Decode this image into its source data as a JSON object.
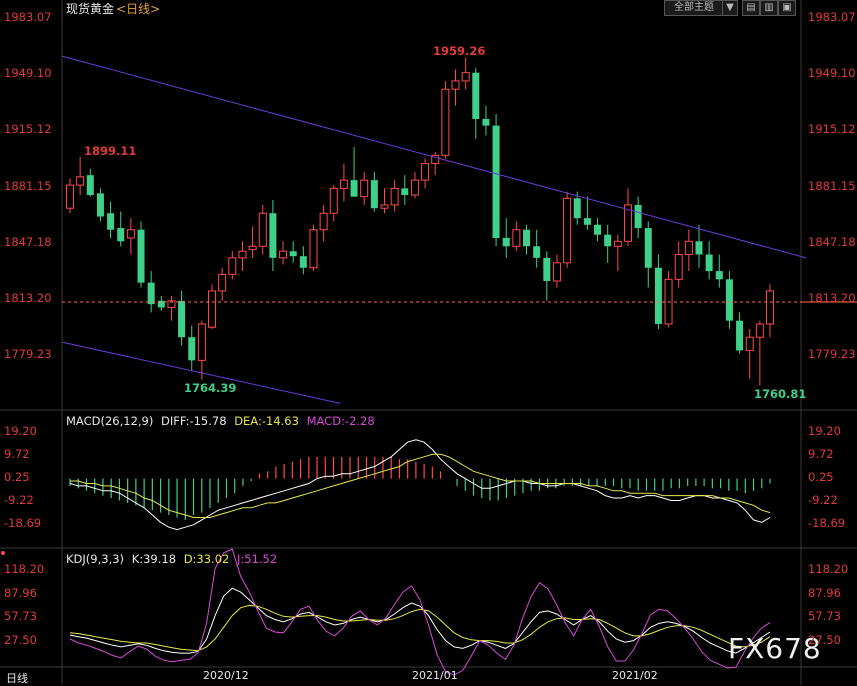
{
  "header": {
    "symbol": "现货黄金",
    "period": "<日线>",
    "theme_button": "全部主题",
    "theme_arrow": "▼",
    "buttons": [
      "▤",
      "▥",
      "▣"
    ]
  },
  "price_axis": {
    "labels": [
      "1983.07",
      "1949.10",
      "1915.12",
      "1881.15",
      "1847.18",
      "1813.20",
      "1779.23"
    ],
    "values": [
      1983.07,
      1949.1,
      1915.12,
      1881.15,
      1847.18,
      1813.2,
      1779.23
    ],
    "current": 1811.3
  },
  "annotations": {
    "high": "1959.26",
    "left_high": "1899.11",
    "left_low": "1764.39",
    "right_low": "1760.81"
  },
  "macd": {
    "title": "MACD(26,12,9)",
    "diff": "DIFF:-15.78",
    "dea": "DEA:-14.63",
    "macd": "MACD:-2.28",
    "axis_labels": [
      "19.20",
      "9.72",
      "0.25",
      "-9.22",
      "-18.69"
    ],
    "axis_values": [
      19.2,
      9.72,
      0.25,
      -9.22,
      -18.69
    ],
    "hist": [
      -3,
      -4,
      -5,
      -6,
      -7,
      -8,
      -9,
      -10,
      -11,
      -12,
      -13,
      -14,
      -15,
      -16,
      -17,
      -15,
      -14,
      -12,
      -10,
      -8,
      -6,
      -3,
      -1,
      2,
      3,
      5,
      6,
      7,
      8,
      9,
      9,
      9,
      9,
      9,
      9,
      9,
      9,
      9,
      9,
      9,
      8,
      8,
      7,
      6,
      5,
      3,
      0,
      -3,
      -5,
      -7,
      -8,
      -9,
      -9,
      -8,
      -7,
      -6,
      -5,
      -5,
      -4,
      -4,
      -3,
      -3,
      -3,
      -3,
      -3,
      -3,
      -3,
      -4,
      -4,
      -5,
      -5,
      -5,
      -5,
      -4,
      -4,
      -3,
      -3,
      -3,
      -4,
      -4,
      -5,
      -5,
      -6,
      -5,
      -4,
      -2
    ],
    "diff_line": [
      -2,
      -3,
      -3,
      -4,
      -5,
      -5,
      -6,
      -8,
      -10,
      -12,
      -15,
      -18,
      -20,
      -21,
      -20,
      -19,
      -17,
      -15,
      -13,
      -12,
      -11,
      -10,
      -9,
      -8,
      -7,
      -6,
      -5,
      -4,
      -3,
      -2,
      0,
      1,
      1,
      2,
      2,
      3,
      4,
      5,
      7,
      9,
      12,
      15,
      16,
      15,
      12,
      8,
      5,
      2,
      0,
      -2,
      -4,
      -4,
      -3,
      -2,
      -1,
      -1,
      -2,
      -2,
      -3,
      -3,
      -2,
      -2,
      -3,
      -4,
      -5,
      -7,
      -8,
      -8,
      -7,
      -8,
      -7,
      -7,
      -8,
      -9,
      -9,
      -8,
      -7,
      -7,
      -8,
      -8,
      -9,
      -10,
      -13,
      -17,
      -18,
      -16
    ],
    "dea_line": [
      -1,
      -1,
      -2,
      -2,
      -3,
      -3,
      -4,
      -5,
      -6,
      -8,
      -9,
      -11,
      -13,
      -14,
      -15,
      -16,
      -16,
      -16,
      -15,
      -14,
      -13,
      -12,
      -12,
      -11,
      -10,
      -10,
      -9,
      -8,
      -7,
      -6,
      -5,
      -4,
      -3,
      -2,
      -1,
      0,
      1,
      2,
      3,
      4,
      5,
      7,
      8,
      9,
      10,
      10,
      9,
      7,
      5,
      3,
      2,
      1,
      0,
      -1,
      -1,
      -1,
      -1,
      -2,
      -2,
      -2,
      -2,
      -2,
      -2,
      -3,
      -3,
      -4,
      -5,
      -5,
      -6,
      -6,
      -6,
      -6,
      -7,
      -7,
      -7,
      -7,
      -7,
      -7,
      -7,
      -8,
      -8,
      -9,
      -10,
      -11,
      -13,
      -14
    ]
  },
  "kdj": {
    "title": "KDJ(9,3,3)",
    "k": "K:39.18",
    "d": "D:33.02",
    "j": "J:51.52",
    "axis_labels": [
      "118.20",
      "87.96",
      "57.73",
      "27.50"
    ],
    "axis_values": [
      118.2,
      87.96,
      57.73,
      27.5
    ],
    "k_line": [
      35,
      33,
      31,
      28,
      25,
      22,
      20,
      22,
      24,
      22,
      18,
      15,
      13,
      12,
      12,
      14,
      30,
      60,
      85,
      95,
      90,
      80,
      70,
      60,
      55,
      52,
      56,
      62,
      64,
      58,
      52,
      48,
      50,
      55,
      58,
      55,
      52,
      55,
      62,
      70,
      76,
      72,
      60,
      42,
      28,
      20,
      18,
      22,
      28,
      26,
      22,
      18,
      24,
      38,
      52,
      64,
      66,
      62,
      55,
      48,
      55,
      60,
      52,
      40,
      30,
      26,
      28,
      35,
      45,
      50,
      52,
      50,
      46,
      40,
      32,
      25,
      20,
      15,
      12,
      18,
      25,
      32,
      39
    ],
    "d_line": [
      38,
      37,
      35,
      33,
      31,
      29,
      27,
      26,
      25,
      25,
      23,
      21,
      19,
      17,
      16,
      15,
      20,
      30,
      45,
      60,
      70,
      73,
      72,
      68,
      63,
      59,
      58,
      59,
      60,
      60,
      58,
      55,
      53,
      53,
      54,
      55,
      54,
      54,
      56,
      60,
      65,
      68,
      66,
      58,
      48,
      38,
      32,
      29,
      28,
      28,
      27,
      25,
      25,
      29,
      36,
      45,
      52,
      56,
      57,
      55,
      55,
      56,
      55,
      50,
      44,
      38,
      34,
      34,
      37,
      41,
      45,
      47,
      47,
      45,
      41,
      36,
      31,
      26,
      21,
      20,
      22,
      26,
      33
    ],
    "j_line": [
      30,
      25,
      22,
      18,
      14,
      9,
      6,
      14,
      21,
      17,
      8,
      3,
      1,
      3,
      4,
      12,
      50,
      120,
      140,
      145,
      110,
      90,
      66,
      44,
      39,
      38,
      52,
      68,
      72,
      54,
      40,
      34,
      44,
      59,
      66,
      55,
      48,
      57,
      74,
      90,
      98,
      80,
      48,
      10,
      -12,
      -16,
      -10,
      8,
      28,
      22,
      12,
      4,
      22,
      56,
      84,
      102,
      94,
      74,
      51,
      34,
      55,
      68,
      46,
      20,
      2,
      2,
      16,
      37,
      61,
      68,
      66,
      56,
      44,
      30,
      14,
      3,
      -2,
      -7,
      -6,
      14,
      31,
      44,
      51
    ]
  },
  "dates": [
    "2020/12",
    "2021/01",
    "2021/02"
  ],
  "footer": {
    "period_label": "日线",
    "watermark": "FX678"
  },
  "chart_data": {
    "type": "candlestick",
    "title": "现货黄金 <日线>",
    "ylim": [
      1760,
      1983.07
    ],
    "ohlc": [
      [
        1868,
        1886,
        1865,
        1882
      ],
      [
        1882,
        1899.11,
        1876,
        1887
      ],
      [
        1888,
        1892,
        1875,
        1876
      ],
      [
        1877,
        1880,
        1860,
        1863
      ],
      [
        1865,
        1872,
        1850,
        1855
      ],
      [
        1856,
        1866,
        1845,
        1848
      ],
      [
        1850,
        1862,
        1840,
        1855
      ],
      [
        1855,
        1860,
        1820,
        1823
      ],
      [
        1823,
        1830,
        1805,
        1810
      ],
      [
        1812,
        1815,
        1806,
        1808
      ],
      [
        1808,
        1815,
        1800,
        1812
      ],
      [
        1812,
        1818,
        1785,
        1790
      ],
      [
        1790,
        1797,
        1770,
        1776
      ],
      [
        1776,
        1800,
        1764.39,
        1798
      ],
      [
        1796,
        1822,
        1795,
        1818
      ],
      [
        1818,
        1832,
        1812,
        1828
      ],
      [
        1828,
        1842,
        1825,
        1838
      ],
      [
        1838,
        1848,
        1830,
        1842
      ],
      [
        1843,
        1857,
        1838,
        1845
      ],
      [
        1845,
        1870,
        1840,
        1865
      ],
      [
        1865,
        1873,
        1830,
        1838
      ],
      [
        1838,
        1848,
        1834,
        1842
      ],
      [
        1842,
        1848,
        1835,
        1839
      ],
      [
        1839,
        1845,
        1828,
        1832
      ],
      [
        1832,
        1858,
        1830,
        1855
      ],
      [
        1855,
        1870,
        1848,
        1865
      ],
      [
        1865,
        1882,
        1860,
        1880
      ],
      [
        1880,
        1895,
        1872,
        1885
      ],
      [
        1885,
        1905,
        1878,
        1875
      ],
      [
        1875,
        1890,
        1870,
        1885
      ],
      [
        1885,
        1890,
        1866,
        1868
      ],
      [
        1868,
        1880,
        1865,
        1870
      ],
      [
        1870,
        1885,
        1866,
        1880
      ],
      [
        1880,
        1888,
        1870,
        1876
      ],
      [
        1876,
        1890,
        1874,
        1885
      ],
      [
        1885,
        1898,
        1880,
        1895
      ],
      [
        1895,
        1902,
        1888,
        1900
      ],
      [
        1900,
        1945,
        1898,
        1940
      ],
      [
        1940,
        1952,
        1930,
        1945
      ],
      [
        1945,
        1959.26,
        1940,
        1950
      ],
      [
        1950,
        1953,
        1910,
        1922
      ],
      [
        1922,
        1930,
        1912,
        1918
      ],
      [
        1918,
        1925,
        1845,
        1850
      ],
      [
        1850,
        1862,
        1838,
        1845
      ],
      [
        1845,
        1860,
        1842,
        1855
      ],
      [
        1855,
        1858,
        1840,
        1845
      ],
      [
        1845,
        1855,
        1832,
        1838
      ],
      [
        1838,
        1842,
        1812,
        1824
      ],
      [
        1824,
        1840,
        1820,
        1835
      ],
      [
        1835,
        1878,
        1832,
        1874
      ],
      [
        1874,
        1878,
        1858,
        1862
      ],
      [
        1862,
        1875,
        1855,
        1858
      ],
      [
        1858,
        1862,
        1848,
        1852
      ],
      [
        1852,
        1858,
        1835,
        1845
      ],
      [
        1845,
        1852,
        1830,
        1848
      ],
      [
        1848,
        1880,
        1845,
        1870
      ],
      [
        1870,
        1875,
        1850,
        1856
      ],
      [
        1856,
        1860,
        1820,
        1832
      ],
      [
        1832,
        1840,
        1795,
        1798
      ],
      [
        1798,
        1830,
        1796,
        1825
      ],
      [
        1825,
        1848,
        1820,
        1840
      ],
      [
        1840,
        1855,
        1830,
        1848
      ],
      [
        1848,
        1858,
        1832,
        1840
      ],
      [
        1840,
        1848,
        1825,
        1830
      ],
      [
        1830,
        1840,
        1820,
        1825
      ],
      [
        1825,
        1830,
        1795,
        1800
      ],
      [
        1800,
        1805,
        1780,
        1782
      ],
      [
        1782,
        1795,
        1765,
        1790
      ],
      [
        1790,
        1800,
        1760.81,
        1798
      ],
      [
        1798,
        1822,
        1790,
        1818
      ]
    ]
  }
}
